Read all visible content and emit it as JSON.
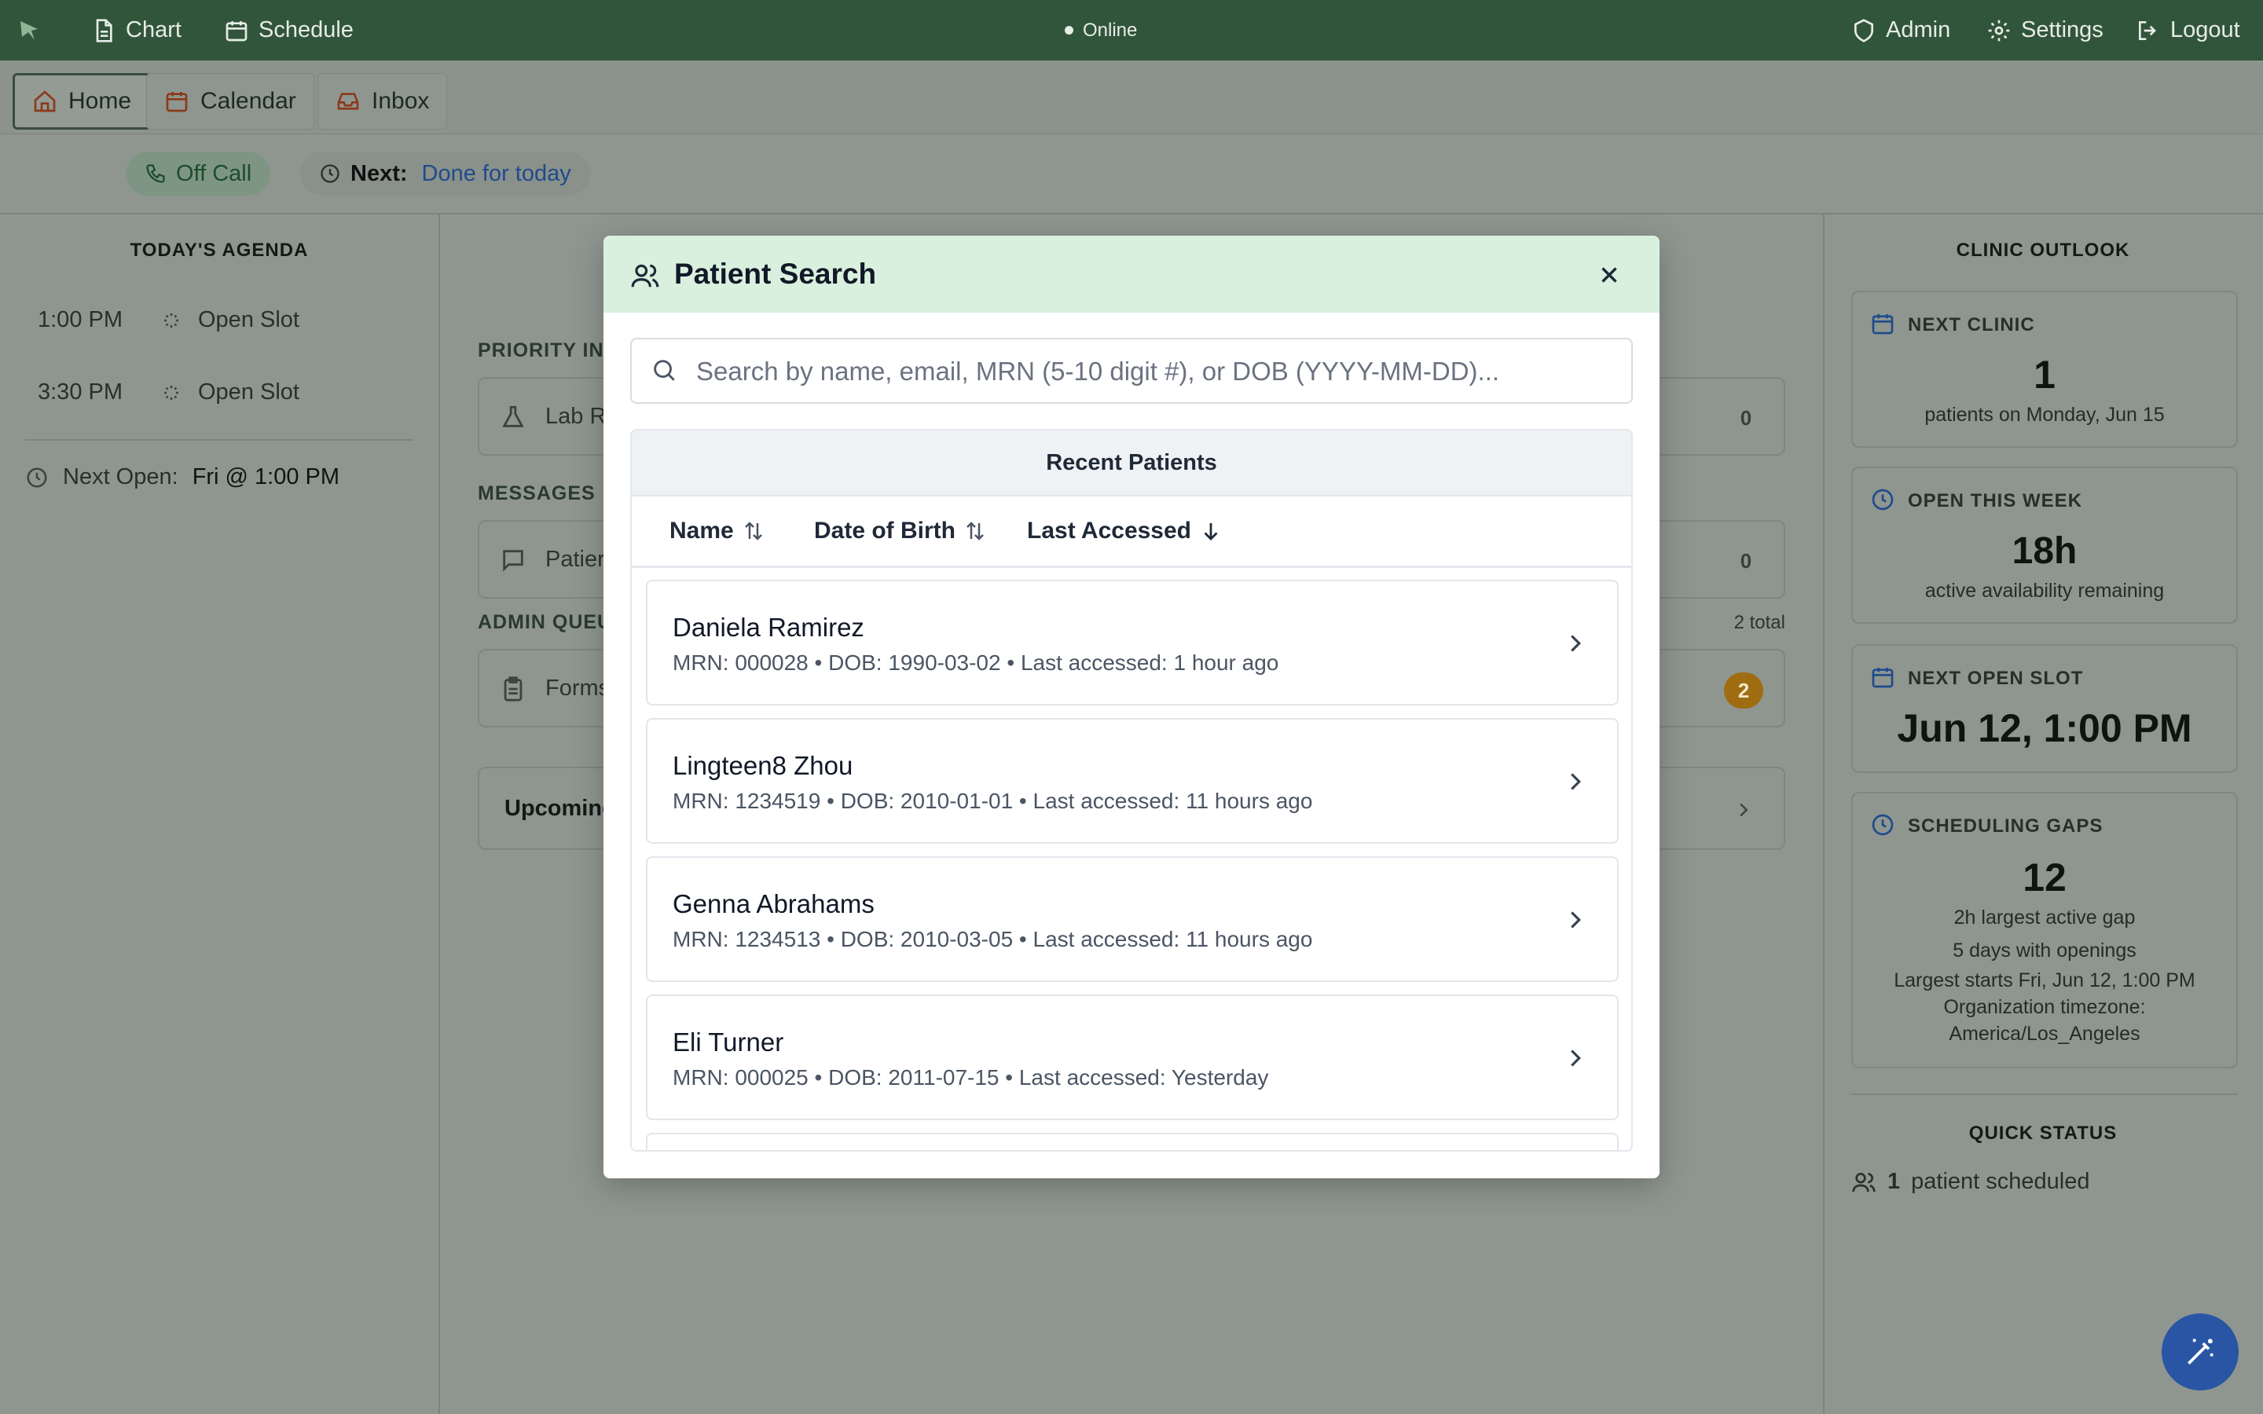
{
  "topbar": {
    "chart": "Chart",
    "schedule": "Schedule",
    "status": "Online",
    "admin": "Admin",
    "settings": "Settings",
    "logout": "Logout"
  },
  "tabs": [
    {
      "label": "Home",
      "active": true
    },
    {
      "label": "Calendar",
      "active": false
    },
    {
      "label": "Inbox",
      "active": false
    }
  ],
  "status_row": {
    "call_status": "Off Call",
    "next_label": "Next:",
    "next_value": "Done for today"
  },
  "agenda": {
    "title": "TODAY'S AGENDA",
    "items": [
      {
        "time": "1:00 PM",
        "label": "Open Slot"
      },
      {
        "time": "3:30 PM",
        "label": "Open Slot"
      }
    ],
    "next_open_label": "Next Open:",
    "next_open_value": "Fri @ 1:00 PM"
  },
  "middle": {
    "priority_label": "PRIORITY INE",
    "lab_row": "Lab R",
    "lab_count": "0",
    "messages_label": "MESSAGES",
    "messages_row": "Patier",
    "messages_count": "0",
    "admin_label": "ADMIN QUEU",
    "admin_total": "2 total",
    "forms_row": "Forms",
    "forms_count": "2",
    "upcoming_row": "Upcoming"
  },
  "outlook": {
    "title": "CLINIC OUTLOOK",
    "cards": [
      {
        "label": "NEXT CLINIC",
        "value": "1",
        "sub": [
          "patients on Monday, Jun 15"
        ]
      },
      {
        "label": "OPEN THIS WEEK",
        "value": "18h",
        "sub": [
          "active availability remaining"
        ]
      },
      {
        "label": "NEXT OPEN SLOT",
        "value": "Jun 12, 1:00 PM",
        "sub": []
      },
      {
        "label": "SCHEDULING GAPS",
        "value": "12",
        "sub": [
          "2h largest active gap",
          "5 days with openings",
          "Largest starts Fri, Jun 12, 1:00 PM",
          "Organization timezone:",
          "America/Los_Angeles"
        ]
      }
    ],
    "quick_status_title": "QUICK STATUS",
    "quick_status_count": "1",
    "quick_status_text": "patient scheduled"
  },
  "modal": {
    "title": "Patient Search",
    "search_placeholder": "Search by name, email, MRN (5-10 digit #), or DOB (YYYY-MM-DD)...",
    "search_value": "",
    "list_title": "Recent Patients",
    "columns": [
      "Name",
      "Date of Birth",
      "Last Accessed"
    ],
    "patients": [
      {
        "name": "Daniela Ramirez",
        "meta": "MRN: 000028 • DOB: 1990-03-02 • Last accessed: 1 hour ago"
      },
      {
        "name": "Lingteen8 Zhou",
        "meta": "MRN: 1234519 • DOB: 2010-01-01 • Last accessed: 11 hours ago"
      },
      {
        "name": "Genna Abrahams",
        "meta": "MRN: 1234513 • DOB: 2010-03-05 • Last accessed: 11 hours ago"
      },
      {
        "name": "Eli Turner",
        "meta": "MRN: 000025 • DOB: 2011-07-15 • Last accessed: Yesterday"
      }
    ]
  },
  "icons": {
    "logo": "leaf-logo-icon",
    "chart": "document-icon",
    "schedule": "calendar-icon",
    "admin": "shield-icon",
    "settings": "gear-icon",
    "logout": "logout-icon",
    "fab": "magic-wand-icon"
  },
  "colors": {
    "topbar": "#31553a",
    "modal_header": "#daf0df",
    "link_blue": "#1f4b8c",
    "badge_amber": "#a06c12",
    "fab_blue": "#2a55a5"
  }
}
